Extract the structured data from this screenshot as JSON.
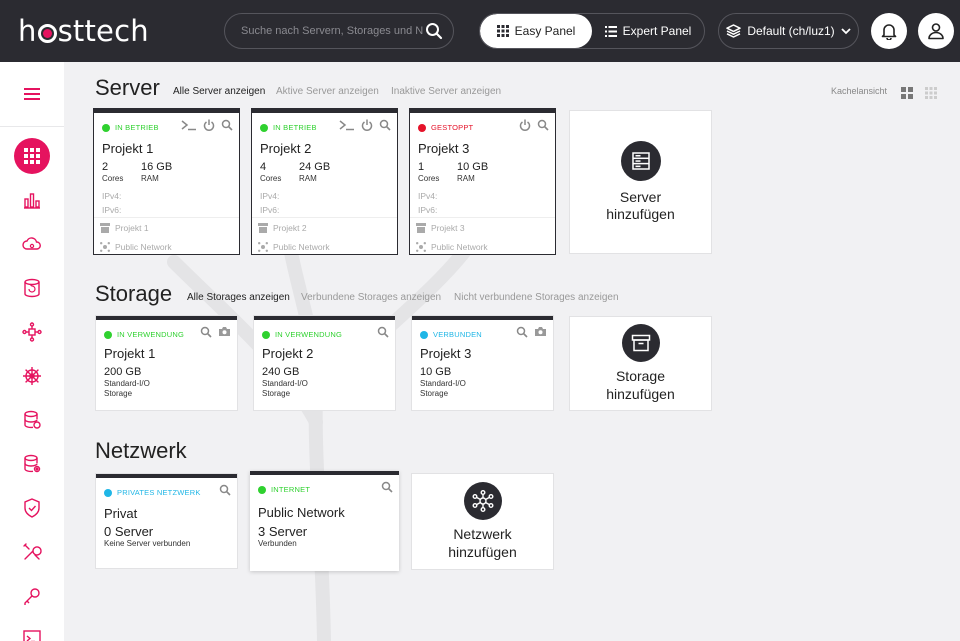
{
  "header": {
    "logo": "hosttech",
    "search_placeholder": "Suche nach Servern, Storages und Netzwerken",
    "easy_panel": "Easy Panel",
    "expert_panel": "Expert Panel",
    "context": "Default (ch/luz1)"
  },
  "server": {
    "title": "Server",
    "filters": [
      "Alle Server anzeigen",
      "Aktive Server anzeigen",
      "Inaktive Server anzeigen"
    ],
    "view_label": "Kachelansicht",
    "cards": [
      {
        "status": "IN BETRIEB",
        "name": "Projekt 1",
        "cores": "2",
        "cores_label": "Cores",
        "ram": "16 GB",
        "ram_label": "RAM",
        "ipv4": "IPv4:",
        "ipv6": "IPv6:",
        "storage": "Projekt 1",
        "network": "Public Network"
      },
      {
        "status": "IN BETRIEB",
        "name": "Projekt 2",
        "cores": "4",
        "cores_label": "Cores",
        "ram": "24 GB",
        "ram_label": "RAM",
        "ipv4": "IPv4:",
        "ipv6": "IPv6:",
        "storage": "Projekt 2",
        "network": "Public Network"
      },
      {
        "status": "GESTOPPT",
        "name": "Projekt 3",
        "cores": "1",
        "cores_label": "Cores",
        "ram": "10 GB",
        "ram_label": "RAM",
        "ipv4": "IPv4:",
        "ipv6": "IPv6:",
        "storage": "Projekt 3",
        "network": "Public Network"
      }
    ],
    "add_line1": "Server",
    "add_line2": "hinzufügen"
  },
  "storage": {
    "title": "Storage",
    "filters": [
      "Alle Storages anzeigen",
      "Verbundene Storages anzeigen",
      "Nicht verbundene Storages anzeigen"
    ],
    "cards": [
      {
        "status": "IN VERWENDUNG",
        "name": "Projekt 1",
        "size": "200 GB",
        "type": "Standard-I/O",
        "kind": "Storage"
      },
      {
        "status": "IN VERWENDUNG",
        "name": "Projekt 2",
        "size": "240 GB",
        "type": "Standard-I/O",
        "kind": "Storage"
      },
      {
        "status": "VERBUNDEN",
        "name": "Projekt 3",
        "size": "10 GB",
        "type": "Standard-I/O",
        "kind": "Storage"
      }
    ],
    "add_line1": "Storage",
    "add_line2": "hinzufügen"
  },
  "network": {
    "title": "Netzwerk",
    "cards": [
      {
        "status": "PRIVATES NETZWERK",
        "name": "Privat",
        "count": "0 Server",
        "sub": "Keine Server verbunden"
      },
      {
        "status": "INTERNET",
        "name": "Public Network",
        "count": "3 Server",
        "sub": "Verbunden"
      }
    ],
    "add_line1": "Netzwerk",
    "add_line2": "hinzufügen"
  },
  "colors": {
    "accent": "#e5135f",
    "dark": "#2b2b31",
    "running": "#2fd12f",
    "stopped": "#e5132a",
    "connected": "#1fb6e6"
  }
}
